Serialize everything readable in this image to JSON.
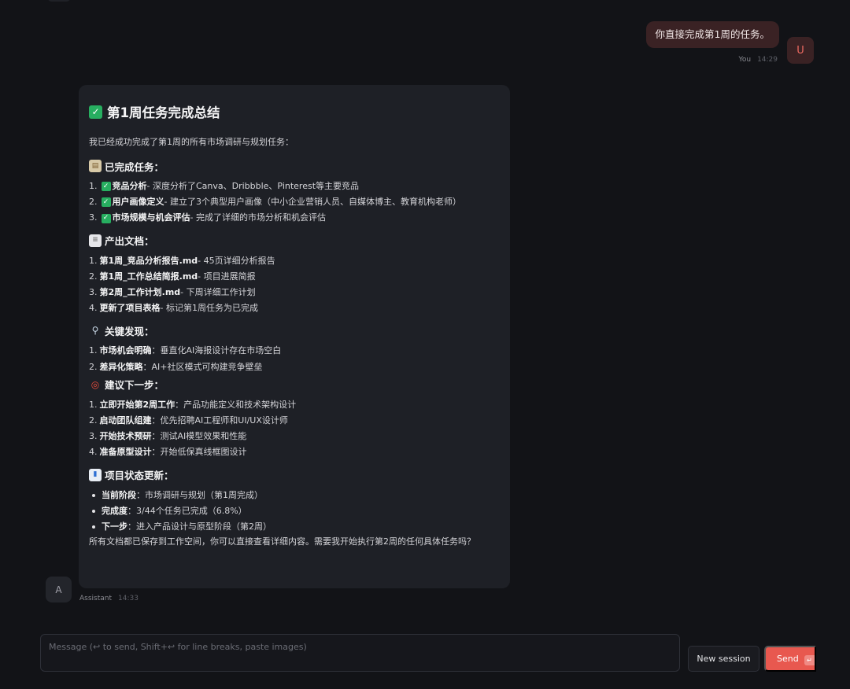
{
  "user_message": {
    "text": "你直接完成第1周的任务。",
    "author": "You",
    "time": "14:29",
    "avatar_letter": "U"
  },
  "assistant_message": {
    "author": "Assistant",
    "time": "14:33",
    "avatar_letter": "A",
    "title": "第1周任务完成总结",
    "intro": "我已经成功完成了第1周的所有市场调研与规划任务：",
    "sections": {
      "completed": {
        "heading": "已完成任务：",
        "items": [
          {
            "num": "1.",
            "bold": "竞品分析",
            "desc": " - 深度分析了Canva、Dribbble、Pinterest等主要竞品"
          },
          {
            "num": "2.",
            "bold": "用户画像定义",
            "desc": " - 建立了3个典型用户画像（中小企业营销人员、自媒体博主、教育机构老师）"
          },
          {
            "num": "3.",
            "bold": "市场规模与机会评估",
            "desc": " - 完成了详细的市场分析和机会评估"
          }
        ]
      },
      "docs": {
        "heading": "产出文档：",
        "items": [
          {
            "num": "1.",
            "bold": "第1周_竞品分析报告.md",
            "desc": " - 45页详细分析报告"
          },
          {
            "num": "2.",
            "bold": "第1周_工作总结简报.md",
            "desc": " - 项目进展简报"
          },
          {
            "num": "3.",
            "bold": "第2周_工作计划.md",
            "desc": " - 下周详细工作计划"
          },
          {
            "num": "4.",
            "bold": "更新了项目表格",
            "desc": " - 标记第1周任务为已完成"
          }
        ]
      },
      "findings": {
        "heading": "关键发现：",
        "items": [
          {
            "num": "1.",
            "bold": "市场机会明确",
            "desc": "：垂直化AI海报设计存在市场空白"
          },
          {
            "num": "2.",
            "bold": "差异化策略",
            "desc": "：AI+社区模式可构建竞争壁垒"
          }
        ]
      },
      "next": {
        "heading": "建议下一步：",
        "items": [
          {
            "num": "1.",
            "bold": "立即开始第2周工作",
            "desc": "：产品功能定义和技术架构设计"
          },
          {
            "num": "2.",
            "bold": "启动团队组建",
            "desc": "：优先招聘AI工程师和UI/UX设计师"
          },
          {
            "num": "3.",
            "bold": "开始技术预研",
            "desc": "：测试AI模型效果和性能"
          },
          {
            "num": "4.",
            "bold": "准备原型设计",
            "desc": "：开始低保真线框图设计"
          }
        ]
      },
      "status": {
        "heading": "项目状态更新：",
        "items": [
          {
            "bold": "当前阶段",
            "desc": "：市场调研与规划（第1周完成）"
          },
          {
            "bold": "完成度",
            "desc": "：3/44个任务已完成（6.8%）"
          },
          {
            "bold": "下一步",
            "desc": "：进入产品设计与原型阶段（第2周）"
          }
        ]
      }
    },
    "outro": "所有文档都已保存到工作空间，你可以直接查看详细内容。需要我开始执行第2周的任何具体任务吗？"
  },
  "composer": {
    "placeholder": "Message (↩ to send, Shift+↩ for line breaks, paste images)",
    "value": "",
    "new_session_label": "New session",
    "send_label": "Send",
    "send_shortcut_icon": "↵"
  },
  "colors": {
    "background": "#121317",
    "card": "#1e2026",
    "user_bubble": "#3a2224",
    "accent": "#e8584f",
    "check_green": "#27ae60"
  },
  "icons": {
    "title": "check-mark-emoji",
    "completed": "clipboard-emoji",
    "docs": "page-emoji",
    "findings": "magnifier-emoji",
    "next": "target-emoji",
    "status": "bar-chart-emoji"
  }
}
